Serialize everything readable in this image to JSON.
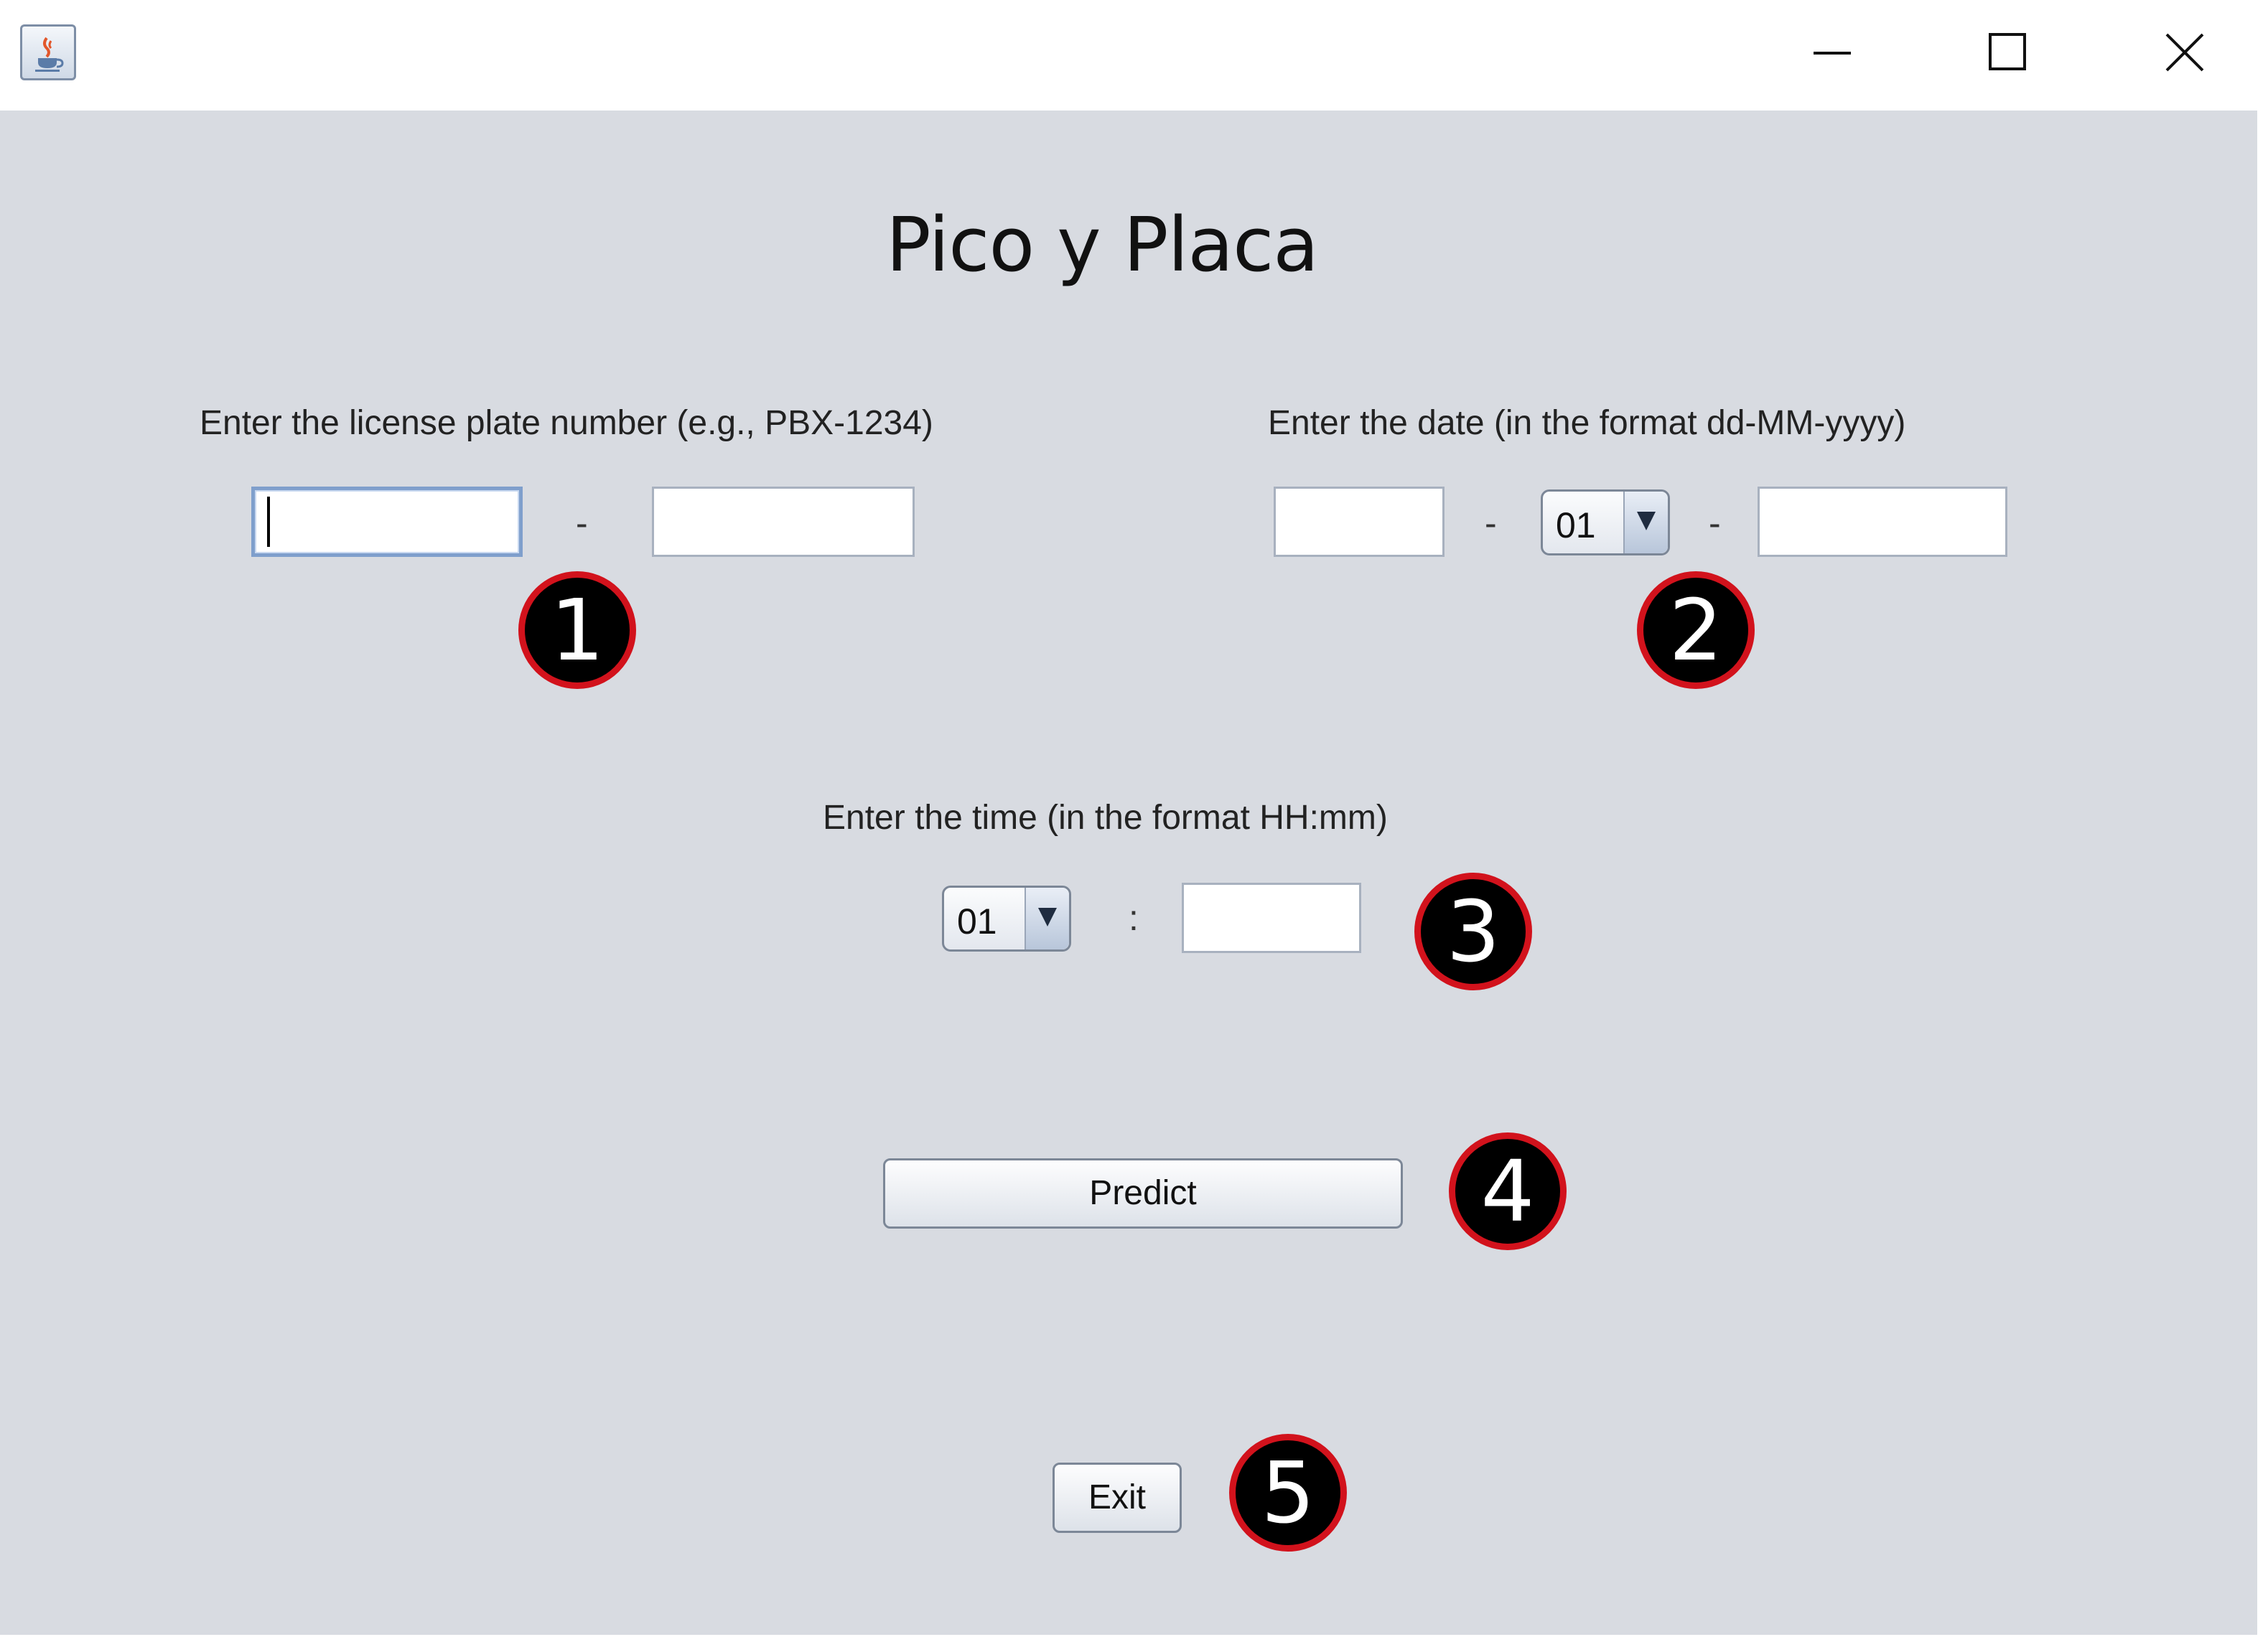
{
  "window": {
    "app_icon": "java-icon",
    "controls": [
      "minimize-icon",
      "maximize-icon",
      "close-icon"
    ]
  },
  "title": "Pico y Placa",
  "plate": {
    "label": "Enter the license plate number (e.g., PBX-1234)",
    "part1_value": "",
    "separator": "-",
    "part2_value": ""
  },
  "date": {
    "label": "Enter the date (in the format dd-MM-yyyy)",
    "day_value": "",
    "separator1": "-",
    "month_selected": "01",
    "separator2": "-",
    "year_value": ""
  },
  "time": {
    "label": "Enter the time (in the format HH:mm)",
    "hour_selected": "01",
    "separator": ":",
    "minute_value": ""
  },
  "buttons": {
    "predict": "Predict",
    "exit": "Exit"
  },
  "callouts": [
    "1",
    "2",
    "3",
    "4",
    "5"
  ],
  "colors": {
    "background": "#d8dbe1",
    "badge_fill": "#000000",
    "badge_ring": "#d2121c",
    "focus_border": "#7f9fcc"
  }
}
